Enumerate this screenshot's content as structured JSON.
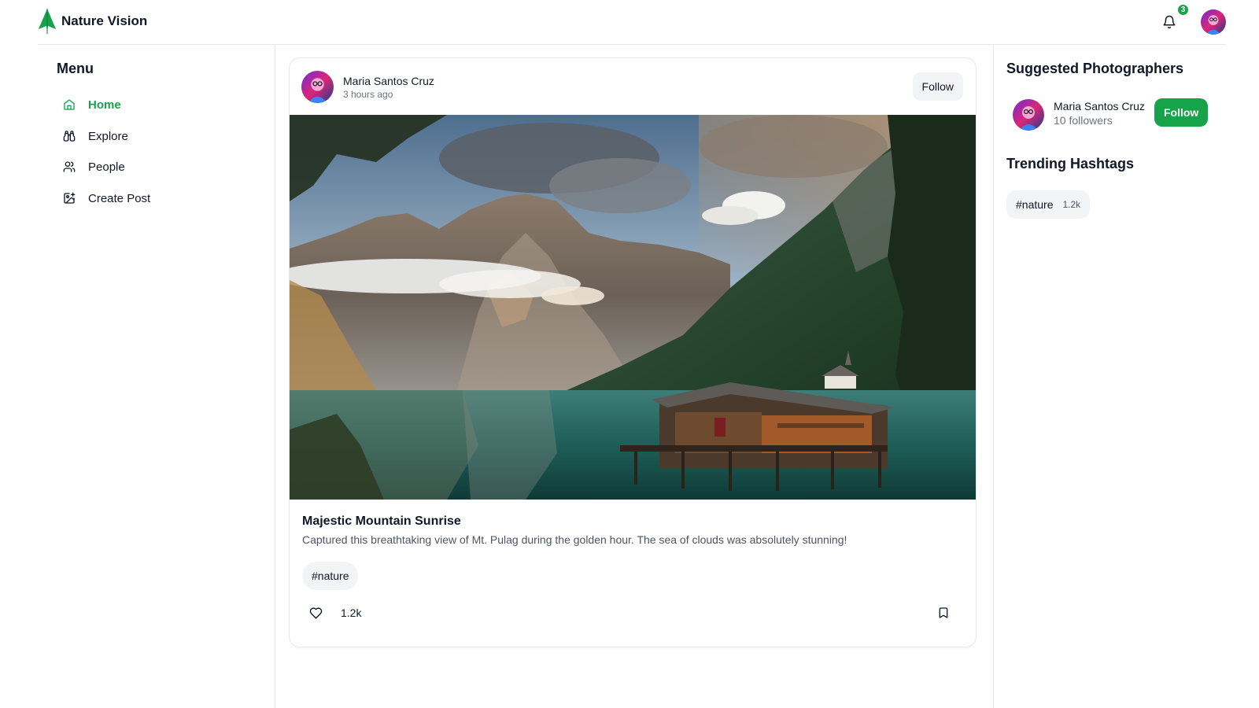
{
  "app": {
    "title": "Nature Vision",
    "logo_icon": "leaf-logo-icon"
  },
  "header": {
    "notifications_count": "3",
    "bell_icon": "bell-icon"
  },
  "sidebar": {
    "title": "Menu",
    "items": [
      {
        "label": "Home",
        "icon": "home-icon",
        "active": true
      },
      {
        "label": "Explore",
        "icon": "binoculars-icon",
        "active": false
      },
      {
        "label": "People",
        "icon": "people-icon",
        "active": false
      },
      {
        "label": "Create Post",
        "icon": "image-plus-icon",
        "active": false
      }
    ]
  },
  "post": {
    "author": "Maria Santos Cruz",
    "time": "3 hours ago",
    "follow_label": "Follow",
    "title": "Majestic Mountain Sunrise",
    "description": "Captured this breathtaking view of Mt. Pulag during the golden hour. The sea of clouds was absolutely stunning!",
    "tag": "#nature",
    "likes": "1.2k",
    "like_icon": "heart-icon",
    "bookmark_icon": "bookmark-icon"
  },
  "right": {
    "suggested_title": "Suggested Photographers",
    "suggested": [
      {
        "name": "Maria Santos Cruz",
        "followers": "10 followers",
        "follow_label": "Follow"
      }
    ],
    "trending_title": "Trending Hashtags",
    "hashtags": [
      {
        "tag": "#nature",
        "count": "1.2k"
      }
    ]
  },
  "colors": {
    "accent": "#16a34a",
    "border": "#e5e7eb",
    "pill": "#f3f4f6",
    "muted": "#6b7280"
  }
}
